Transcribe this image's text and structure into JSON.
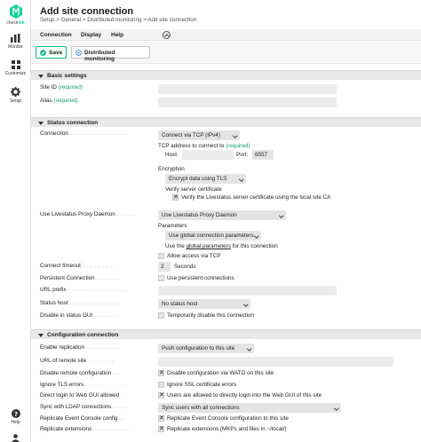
{
  "sidebar": {
    "logo_text_a": "check",
    "logo_text_b": "mk",
    "items": [
      {
        "label": "Monitor",
        "icon": "bar-chart-icon"
      },
      {
        "label": "Customize",
        "icon": "grid-icon"
      },
      {
        "label": "Setup",
        "icon": "gear-icon"
      }
    ],
    "help_label": "Help",
    "user_label": "User"
  },
  "header": {
    "title": "Add site connection",
    "breadcrumb": "Setup > General > Distributed monitoring > Add site connection"
  },
  "menu": [
    "Connection",
    "Display",
    "Help"
  ],
  "toolbar": {
    "save_label": "Save",
    "dist_label": "Distributed monitoring"
  },
  "basic": {
    "title": "Basic settings",
    "site_id_label": "Site ID",
    "alias_label": "Alias",
    "required": "(required)"
  },
  "status": {
    "title": "Status connection",
    "connection_label": "Connection",
    "connection_value": "Connect via TCP (IPv4)",
    "tcp_caption": "TCP address to connect to",
    "required": "(required)",
    "host_label": "Host:",
    "port_label": "Port:",
    "port_value": "6557",
    "encryption_label": "Encryption",
    "encryption_value": "Encrypt data using TLS",
    "verify_label": "Verify server certificate",
    "verify_check_label": "Verify the Livestatus server certificate using the local site CA",
    "proxy_label": "Use Livestatus Proxy Daemon",
    "proxy_value": "Use Livestatus Proxy Daemon",
    "params_label": "Parameters",
    "params_value": "Use global connection parameters",
    "params_note_a": "Use the",
    "params_note_link": "global parameters",
    "params_note_b": "for this connection",
    "allow_tcp_label": "Allow access via TCP",
    "timeout_label": "Connect timeout",
    "timeout_value": "2",
    "timeout_unit": "Seconds",
    "persistent_label": "Persistent Connection",
    "persistent_check": "Use persistent connections",
    "url_prefix_label": "URL prefix",
    "status_host_label": "Status host",
    "status_host_value": "No status host",
    "disable_label": "Disable in status GUI",
    "disable_check": "Temporarily disable this connection"
  },
  "config": {
    "title": "Configuration connection",
    "replication_label": "Enable replication",
    "replication_value": "Push configuration to this site",
    "url_remote_label": "URL of remote site",
    "disable_remote_label": "Disable remote configuration",
    "disable_remote_check": "Disable configuration via WATO on this site",
    "ignore_tls_label": "Ignore TLS errors",
    "ignore_tls_check": "Ignore SSL certificate errors",
    "direct_login_label": "Direct login to Web GUI allowed",
    "direct_login_check": "Users are allowed to directly login into the Web GUI of this site",
    "ldap_label": "Sync with LDAP connections",
    "ldap_value": "Sync users with all connections",
    "ec_label": "Replicate Event Console config",
    "ec_check": "Replicate Event Console configuration to this site",
    "ext_label": "Replicate extensions",
    "ext_check": "Replicate extensions (MKPs and files in ~/local/)"
  },
  "colors": {
    "brand": "#15d1a0",
    "save_border": "#15b98a",
    "required": "#15a070"
  }
}
